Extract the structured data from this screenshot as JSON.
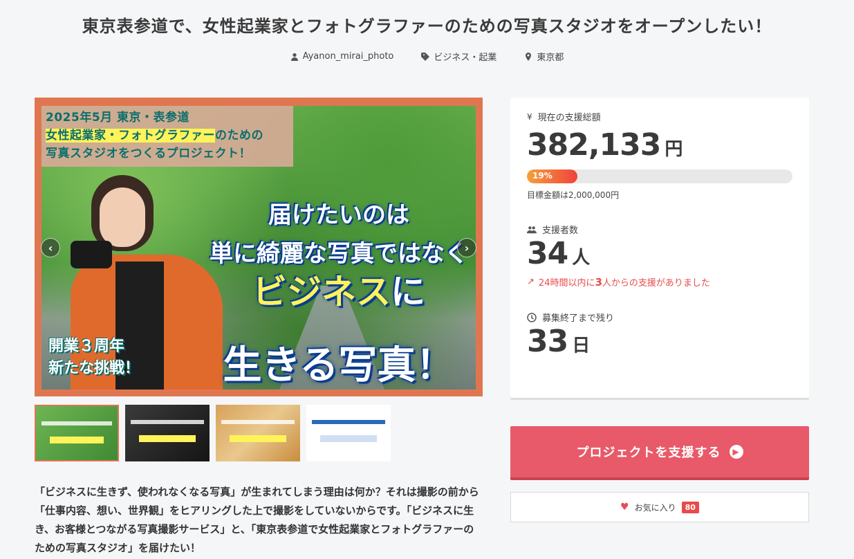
{
  "project": {
    "title": "東京表参道で、女性起業家とフォトグラファーのための写真スタジオをオープンしたい！",
    "author": "Ayanon_mirai_photo",
    "category": "ビジネス・起業",
    "location": "東京都"
  },
  "hero": {
    "banner_line1": "2025年5月 東京・表参道",
    "banner_line2_highlight": "女性起業家・フォトグラファー",
    "banner_line2_rest": "のための",
    "banner_line3": "写真スタジオをつくるプロジェクト！",
    "headline_line1": "届けたいのは",
    "headline_line2": "単に綺麗な写真ではなく",
    "headline_highlight": "ビジネス",
    "headline_particle": "に",
    "headline_line4": "生きる写真！",
    "anniversary_line1": "開業３周年",
    "anniversary_line2": "新たな挑戦！",
    "prev_label": "‹",
    "next_label": "›"
  },
  "description": "「ビジネスに生きず、使われなくなる写真」が生まれてしまう理由は何か？それは撮影の前から「仕事内容、想い、世界観」をヒアリングした上で撮影をしていないからです。「ビジネスに生き、お客様とつながる写真撮影サービス」と、「東京表参道で女性起業家とフォトグラファーのための写真スタジオ」を届けたい！",
  "stats": {
    "amount_label": "現在の支援総額",
    "amount_value": "382,133",
    "amount_unit": "円",
    "progress_percent": 19,
    "progress_text": "19%",
    "goal_text": "目標金額は2,000,000円",
    "supporters_label": "支援者数",
    "supporters_value": "34",
    "supporters_unit": "人",
    "trend_prefix": "24時間以内に",
    "trend_count": "3",
    "trend_suffix": "人からの支援がありました",
    "remaining_label": "募集終了まで残り",
    "remaining_value": "33",
    "remaining_unit": "日"
  },
  "actions": {
    "support_label": "プロジェクトを支援する",
    "favorite_label": "お気に入り",
    "favorite_count": "80"
  },
  "colors": {
    "accent": "#e85a69",
    "trend": "#e84b4b",
    "hero_frame": "#e07650"
  }
}
